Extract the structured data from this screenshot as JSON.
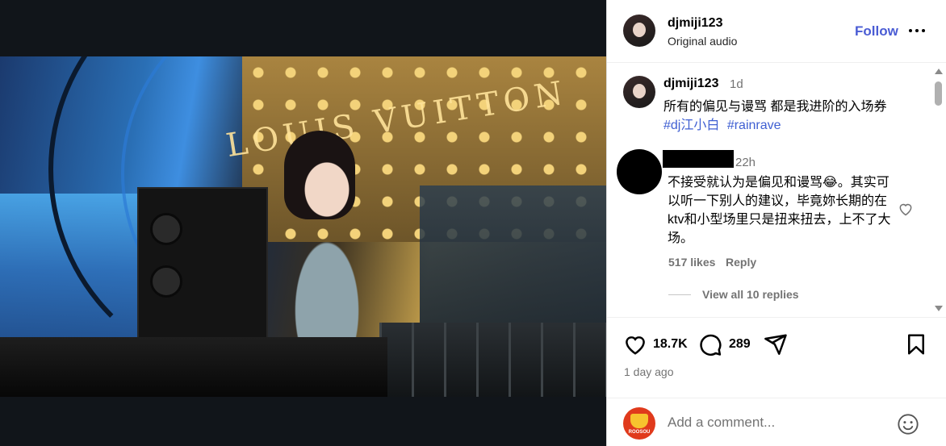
{
  "post": {
    "username": "djmiji123",
    "audio": "Original audio",
    "follow_label": "Follow"
  },
  "caption": {
    "username": "djmiji123",
    "time": "1d",
    "text": "所有的偏见与谩骂 都是我进阶的入场券",
    "tags": [
      "#dj江小白",
      "#rainrave"
    ]
  },
  "video_overlay": {
    "sign_text": "LOUIS VUITTON"
  },
  "comment": {
    "time": "22h",
    "text": "不接受就认为是偏见和谩骂😂。其实可以听一下别人的建议，毕竟妳长期的在ktv和小型场里只是扭来扭去，上不了大场。",
    "likes": "517 likes",
    "reply_label": "Reply",
    "view_replies": "View all 10 replies"
  },
  "actions": {
    "like_count": "18.7K",
    "comment_count": "289",
    "posted": "1 day ago"
  },
  "composer": {
    "placeholder": "Add a comment...",
    "avatar_label": "ROOSOU"
  },
  "icons": {
    "more": "more-horizontal-icon",
    "like": "heart-icon",
    "comment": "comment-bubble-icon",
    "share": "paper-plane-icon",
    "save": "bookmark-icon",
    "emoji": "smiley-icon",
    "mute": "speaker-muted-icon"
  },
  "colors": {
    "accent": "#4a5cd4",
    "hashtag": "#3f5fd2",
    "secondary_text": "#737373"
  }
}
